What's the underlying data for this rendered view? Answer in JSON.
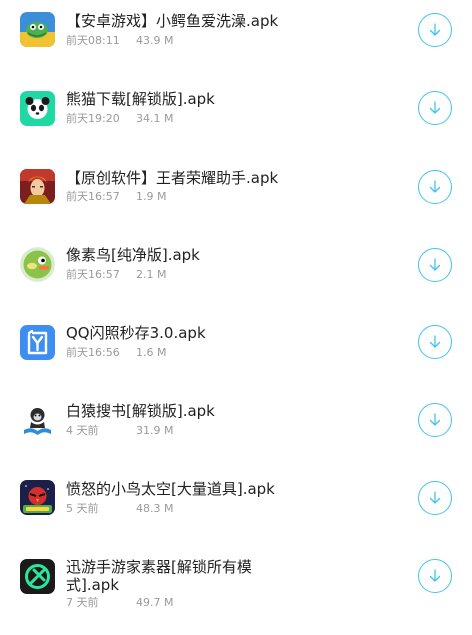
{
  "colors": {
    "accent": "#42c3ee",
    "title_text": "#222222",
    "meta_text": "#9a9a9a"
  },
  "items": [
    {
      "title": "【安卓游戏】小鳄鱼爱洗澡.apk",
      "time": "前天08:11",
      "size": "43.9 M",
      "icon": "crocodile-app-icon"
    },
    {
      "title": "熊猫下载[解锁版].apk",
      "time": "前天19:20",
      "size": "34.1 M",
      "icon": "panda-app-icon"
    },
    {
      "title": "【原创软件】王者荣耀助手.apk",
      "time": "前天16:57",
      "size": "1.9 M",
      "icon": "hero-app-icon"
    },
    {
      "title": "像素鸟[纯净版].apk",
      "time": "前天16:57",
      "size": "2.1 M",
      "icon": "flappy-bird-app-icon"
    },
    {
      "title": "QQ闪照秒存3.0.apk",
      "time": "前天16:56",
      "size": "1.6 M",
      "icon": "flash-app-icon"
    },
    {
      "title": "白猿搜书[解锁版].apk",
      "time": "4 天前",
      "size": "31.9 M",
      "icon": "ape-book-app-icon"
    },
    {
      "title": "愤怒的小鸟太空[大量道具].apk",
      "time": "5 天前",
      "size": "48.3 M",
      "icon": "angry-birds-space-app-icon"
    },
    {
      "title": "迅游手游家素器[解锁所有模式].apk",
      "time": "7 天前",
      "size": "49.7 M",
      "icon": "xunyou-app-icon"
    }
  ]
}
